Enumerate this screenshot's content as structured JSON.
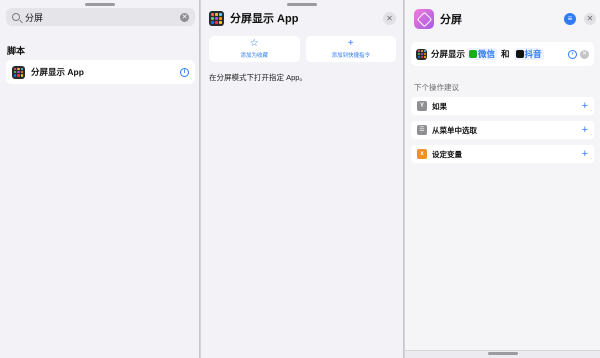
{
  "search": {
    "query": "分屏",
    "clear_icon": "clear-icon"
  },
  "scripts_section": {
    "title": "脚本"
  },
  "result": {
    "label": "分屏显示 App"
  },
  "detail": {
    "title": "分屏显示 App",
    "add_favorite_label": "添加为收藏",
    "add_shortcut_label": "添加到快捷指令",
    "description": "在分屏模式下打开指定 App。"
  },
  "editor": {
    "title": "分屏",
    "action": {
      "verb": "分屏显示",
      "app1": "微信",
      "conjunction": "和",
      "app2": "抖音"
    },
    "suggestions_title": "下个操作建议",
    "suggestions": [
      {
        "label": "如果",
        "icon": "if-icon",
        "color": "#8e8e93"
      },
      {
        "label": "从菜单中选取",
        "icon": "menu-list-icon",
        "color": "#8e8e93"
      },
      {
        "label": "设定变量",
        "icon": "variable-icon",
        "color": "#f0902a"
      }
    ]
  },
  "colors": {
    "accent": "#2f7cf6",
    "wechat": "#1aad19",
    "tiktok": "#111111"
  }
}
